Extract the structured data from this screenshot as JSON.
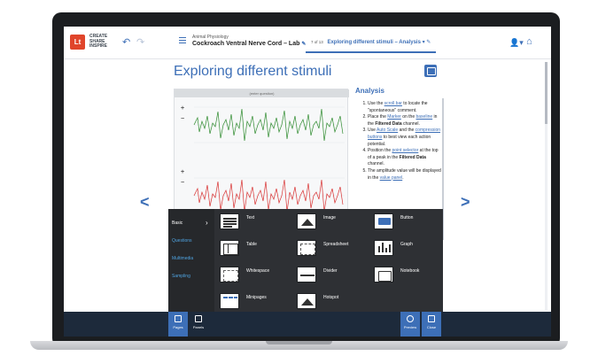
{
  "logo": {
    "mark": "Lt",
    "tagline": [
      "CREATE",
      "SHARE",
      "INSPIRE"
    ]
  },
  "course": {
    "subtitle": "Animal Physiology",
    "title": "Cockroach Ventral Nerve Cord – Lab",
    "edit_icon": "pencil-icon"
  },
  "page_tab": {
    "number": "7 of 13",
    "label": "Exploring different stimuli – Analysis",
    "dropdown_icon": "chevron-down-icon"
  },
  "page_title": "Exploring different stimuli",
  "chart": {
    "enter_question": "(enter question)",
    "toolbar": [
      "+",
      "−",
      "+",
      "−"
    ]
  },
  "analysis": {
    "heading": "Analysis",
    "steps": [
      [
        "Use the ",
        "scroll bar",
        " to locate the \"spontaneous\" comment."
      ],
      [
        "Place the ",
        "Marker",
        " on the ",
        "baseline",
        " in the ",
        "Filtered Data",
        " channel."
      ],
      [
        "Use ",
        "Auto Scale",
        " and the ",
        "compression buttons",
        " to best view each action potential."
      ],
      [
        "Position the ",
        "point selector",
        " at the top of a peak in the ",
        "Filtered Data",
        " channel."
      ],
      [
        "The amplitude value will be displayed in the ",
        "value panel",
        "."
      ]
    ]
  },
  "picker": {
    "categories": [
      {
        "label": "Basic",
        "active": true
      },
      {
        "label": "Questions",
        "active": false
      },
      {
        "label": "Multimedia",
        "active": false
      },
      {
        "label": "Sampling",
        "active": false
      }
    ],
    "tiles": [
      "Text",
      "Image",
      "Button",
      "Table",
      "Spreadsheet",
      "Graph",
      "Whitespace",
      "Divider",
      "Notebook",
      "Minipages",
      "Hotspot"
    ]
  },
  "bottombar": {
    "pages": "Pages",
    "panels": "Panels",
    "preview": "Preview",
    "close": "Close"
  },
  "colors": {
    "accent": "#3d6fb7",
    "raw_trace": "#2e8b2e",
    "filtered_trace": "#d83030",
    "picker_bg": "#2e3034",
    "bottombar_bg": "#1d2a3b"
  }
}
